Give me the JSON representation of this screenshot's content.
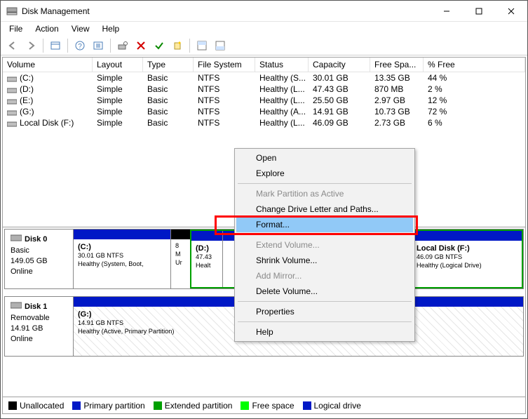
{
  "window": {
    "title": "Disk Management"
  },
  "menubar": [
    "File",
    "Action",
    "View",
    "Help"
  ],
  "columns": {
    "volume": "Volume",
    "layout": "Layout",
    "type": "Type",
    "fs": "File System",
    "status": "Status",
    "capacity": "Capacity",
    "free": "Free Spa...",
    "pct": "% Free"
  },
  "volumes": [
    {
      "name": "(C:)",
      "layout": "Simple",
      "type": "Basic",
      "fs": "NTFS",
      "status": "Healthy (S...",
      "capacity": "30.01 GB",
      "free": "13.35 GB",
      "pct": "44 %"
    },
    {
      "name": "(D:)",
      "layout": "Simple",
      "type": "Basic",
      "fs": "NTFS",
      "status": "Healthy (L...",
      "capacity": "47.43 GB",
      "free": "870 MB",
      "pct": "2 %"
    },
    {
      "name": "(E:)",
      "layout": "Simple",
      "type": "Basic",
      "fs": "NTFS",
      "status": "Healthy (L...",
      "capacity": "25.50 GB",
      "free": "2.97 GB",
      "pct": "12 %"
    },
    {
      "name": "(G:)",
      "layout": "Simple",
      "type": "Basic",
      "fs": "NTFS",
      "status": "Healthy (A...",
      "capacity": "14.91 GB",
      "free": "10.73 GB",
      "pct": "72 %"
    },
    {
      "name": "Local Disk  (F:)",
      "layout": "Simple",
      "type": "Basic",
      "fs": "NTFS",
      "status": "Healthy (L...",
      "capacity": "46.09 GB",
      "free": "2.73 GB",
      "pct": "6 %"
    }
  ],
  "disks": {
    "0": {
      "name": "Disk 0",
      "type": "Basic",
      "size": "149.05 GB",
      "state": "Online",
      "parts": {
        "c": {
          "title": "(C:)",
          "line2": "30.01 GB NTFS",
          "line3": "Healthy (System, Boot,"
        },
        "ur": {
          "line2": "8 M",
          "line3": "Ur"
        },
        "d": {
          "title": "(D:)",
          "line2": "47.43",
          "line3": "Healt"
        },
        "f": {
          "title": "Local Disk   (F:)",
          "line2": "46.09 GB NTFS",
          "line3": "Healthy (Logical Drive)"
        }
      }
    },
    "1": {
      "name": "Disk 1",
      "type": "Removable",
      "size": "14.91 GB",
      "state": "Online",
      "parts": {
        "g": {
          "title": "(G:)",
          "line2": "14.91 GB NTFS",
          "line3": "Healthy (Active, Primary Partition)"
        }
      }
    }
  },
  "legend": {
    "unalloc": "Unallocated",
    "primary": "Primary partition",
    "extended": "Extended partition",
    "free": "Free space",
    "logical": "Logical drive"
  },
  "context_menu": {
    "open": "Open",
    "explore": "Explore",
    "mark_active": "Mark Partition as Active",
    "change_letter": "Change Drive Letter and Paths...",
    "format": "Format...",
    "extend": "Extend Volume...",
    "shrink": "Shrink Volume...",
    "add_mirror": "Add Mirror...",
    "delete": "Delete Volume...",
    "properties": "Properties",
    "help": "Help"
  }
}
